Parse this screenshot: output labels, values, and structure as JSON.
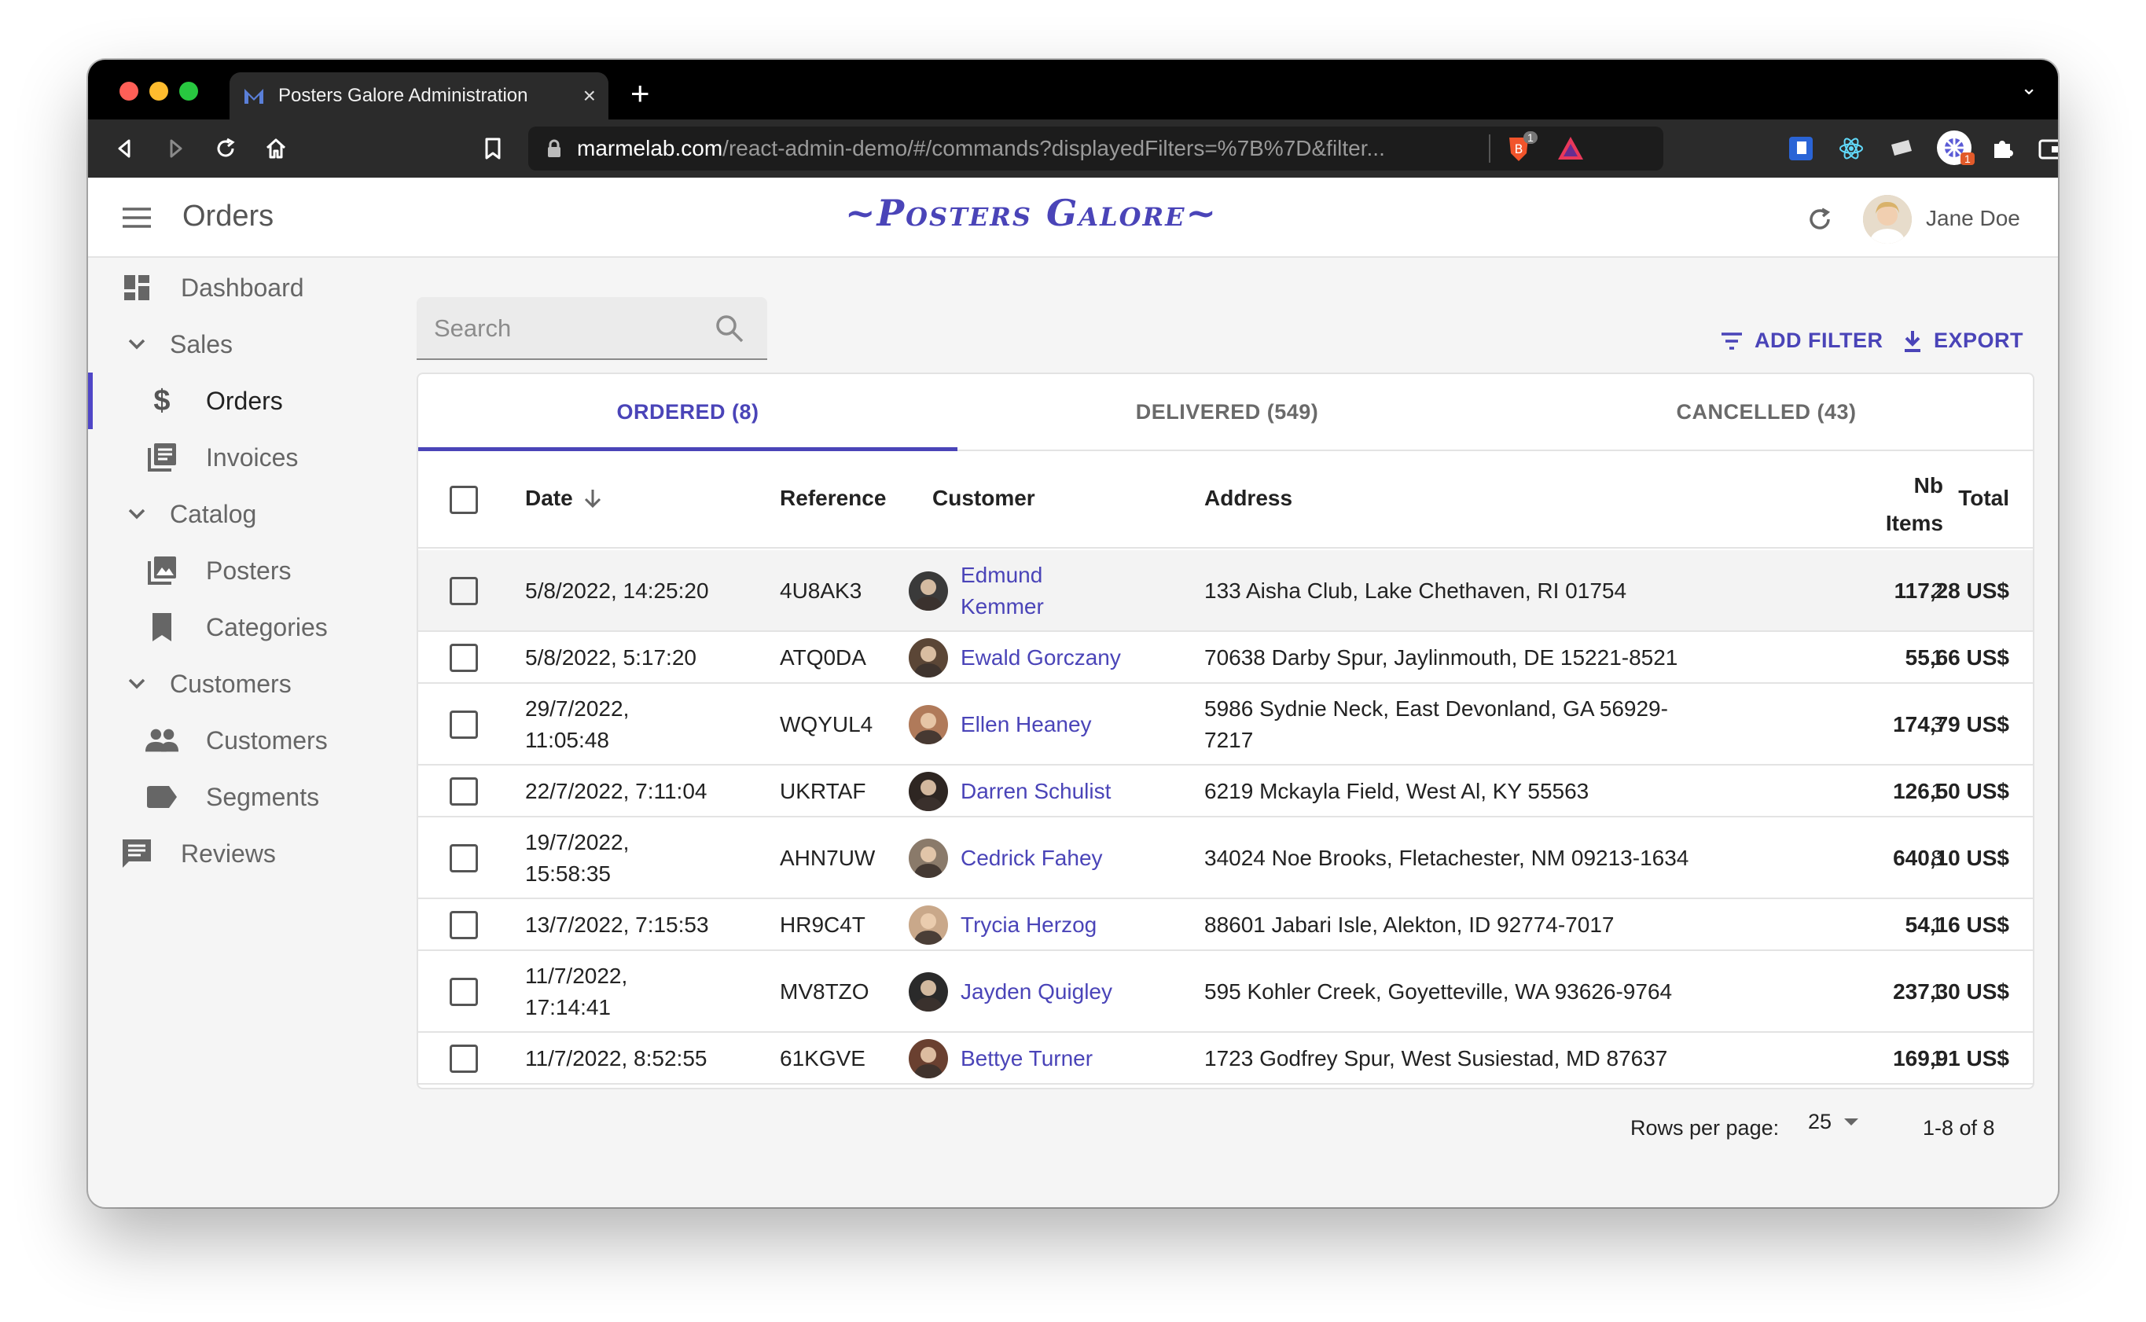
{
  "browser": {
    "tab_title": "Posters Galore Administration",
    "url_host": "marmelab.com",
    "url_path": "/react-admin-demo/#/commands?displayedFilters=%7B%7D&filter...",
    "ext_badge": "1"
  },
  "appbar": {
    "page_title": "Orders",
    "brand": "~Posters Galore~",
    "user_name": "Jane Doe"
  },
  "sidebar": {
    "items": [
      {
        "label": "Dashboard",
        "icon": "dashboard-icon"
      },
      {
        "label": "Sales",
        "icon": "chevron-down-icon"
      },
      {
        "label": "Orders",
        "icon": "dollar-icon",
        "active": true
      },
      {
        "label": "Invoices",
        "icon": "invoices-icon"
      },
      {
        "label": "Catalog",
        "icon": "chevron-down-icon"
      },
      {
        "label": "Posters",
        "icon": "image-icon"
      },
      {
        "label": "Categories",
        "icon": "bookmark-icon"
      },
      {
        "label": "Customers",
        "icon": "chevron-down-icon"
      },
      {
        "label": "Customers",
        "icon": "people-icon"
      },
      {
        "label": "Segments",
        "icon": "label-icon"
      },
      {
        "label": "Reviews",
        "icon": "comment-icon"
      }
    ]
  },
  "search": {
    "placeholder": "Search"
  },
  "actions": {
    "add_filter": "ADD FILTER",
    "export": "EXPORT"
  },
  "tabs": [
    {
      "label": "ORDERED (8)",
      "active": true
    },
    {
      "label": "DELIVERED (549)"
    },
    {
      "label": "CANCELLED (43)"
    }
  ],
  "table": {
    "headers": {
      "date": "Date",
      "reference": "Reference",
      "customer": "Customer",
      "address": "Address",
      "nb_items_1": "Nb",
      "nb_items_2": "Items",
      "total": "Total"
    },
    "rows": [
      {
        "date1": "5/8/2022, 14:25:20",
        "date2": "",
        "ref": "4U8AK3",
        "cust1": "Edmund",
        "cust2": "Kemmer",
        "addr1": "133 Aisha Club, Lake Chethaven, RI 01754",
        "addr2": "",
        "items": "2",
        "total": "117,28 US$"
      },
      {
        "date1": "5/8/2022, 5:17:20",
        "date2": "",
        "ref": "ATQ0DA",
        "cust1": "Ewald Gorczany",
        "cust2": "",
        "addr1": "70638 Darby Spur, Jaylinmouth, DE 15221-8521",
        "addr2": "",
        "items": "1",
        "total": "55,66 US$"
      },
      {
        "date1": "29/7/2022,",
        "date2": "11:05:48",
        "ref": "WQYUL4",
        "cust1": "Ellen Heaney",
        "cust2": "",
        "addr1": "5986 Sydnie Neck, East Devonland, GA 56929-",
        "addr2": "7217",
        "items": "3",
        "total": "174,79 US$"
      },
      {
        "date1": "22/7/2022, 7:11:04",
        "date2": "",
        "ref": "UKRTAF",
        "cust1": "Darren Schulist",
        "cust2": "",
        "addr1": "6219 Mckayla Field, West Al, KY 55563",
        "addr2": "",
        "items": "1",
        "total": "126,50 US$"
      },
      {
        "date1": "19/7/2022,",
        "date2": "15:58:35",
        "ref": "AHN7UW",
        "cust1": "Cedrick Fahey",
        "cust2": "",
        "addr1": "34024 Noe Brooks, Fletachester, NM 09213-1634",
        "addr2": "",
        "items": "8",
        "total": "640,10 US$"
      },
      {
        "date1": "13/7/2022, 7:15:53",
        "date2": "",
        "ref": "HR9C4T",
        "cust1": "Trycia Herzog",
        "cust2": "",
        "addr1": "88601 Jabari Isle, Alekton, ID 92774-7017",
        "addr2": "",
        "items": "1",
        "total": "54,16 US$"
      },
      {
        "date1": "11/7/2022,",
        "date2": "17:14:41",
        "ref": "MV8TZO",
        "cust1": "Jayden Quigley",
        "cust2": "",
        "addr1": "595 Kohler Creek, Goyetteville, WA 93626-9764",
        "addr2": "",
        "items": "1",
        "total": "237,30 US$"
      },
      {
        "date1": "11/7/2022, 8:52:55",
        "date2": "",
        "ref": "61KGVE",
        "cust1": "Bettye Turner",
        "cust2": "",
        "addr1": "1723 Godfrey Spur, West Susiestad, MD 87637",
        "addr2": "",
        "items": "1",
        "total": "169,91 US$"
      }
    ]
  },
  "pagination": {
    "rows_per_page_label": "Rows per page:",
    "rows_per_page": "25",
    "range": "1-8 of 8"
  },
  "colors": {
    "accent": "#4a44b8",
    "active_bar": "#4f46c7"
  }
}
